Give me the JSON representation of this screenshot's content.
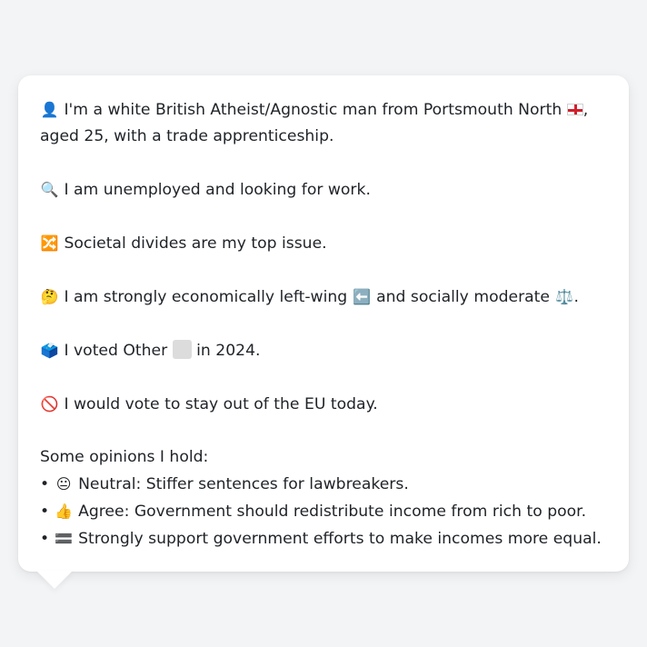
{
  "profile": {
    "identity": {
      "icon": "person-silhouette-icon",
      "text_before": "I'm a white British Atheist/Agnostic man from Portsmouth North",
      "flag_icon": "england-flag-icon",
      "text_after": ", aged 25, with a trade apprenticeship."
    },
    "employment": {
      "icon": "magnifying-glass-icon",
      "text": "I am unemployed and looking for work."
    },
    "top_issue": {
      "icon": "shuffle-icon",
      "text": "Societal divides are my top issue."
    },
    "ideology": {
      "icon": "thinking-face-icon",
      "text_part1": "I am strongly economically left-wing",
      "left_icon": "left-arrow-icon",
      "text_part2": "and socially moderate",
      "scales_icon": "balance-scale-icon",
      "text_end": "."
    },
    "vote_2024": {
      "icon": "ballot-box-icon",
      "text_before": "I voted Other",
      "party_icon": "gray-square-icon",
      "text_after": "in 2024."
    },
    "eu": {
      "icon": "prohibited-icon",
      "text": "I would vote to stay out of the EU today."
    },
    "opinions_heading": "Some opinions I hold:",
    "opinions": [
      {
        "bullet": "•",
        "icon": "neutral-face-icon",
        "text": "Neutral: Stiffer sentences for lawbreakers."
      },
      {
        "bullet": "•",
        "icon": "thumbs-up-icon",
        "text": "Agree: Government should redistribute income from rich to poor."
      },
      {
        "bullet": "•",
        "icon": "equals-icon",
        "text": "Strongly support government efforts to make incomes more equal."
      }
    ]
  },
  "colors": {
    "background": "#f3f4f6",
    "card": "#ffffff",
    "text": "#1f2328",
    "flag_red": "#d0202c"
  }
}
